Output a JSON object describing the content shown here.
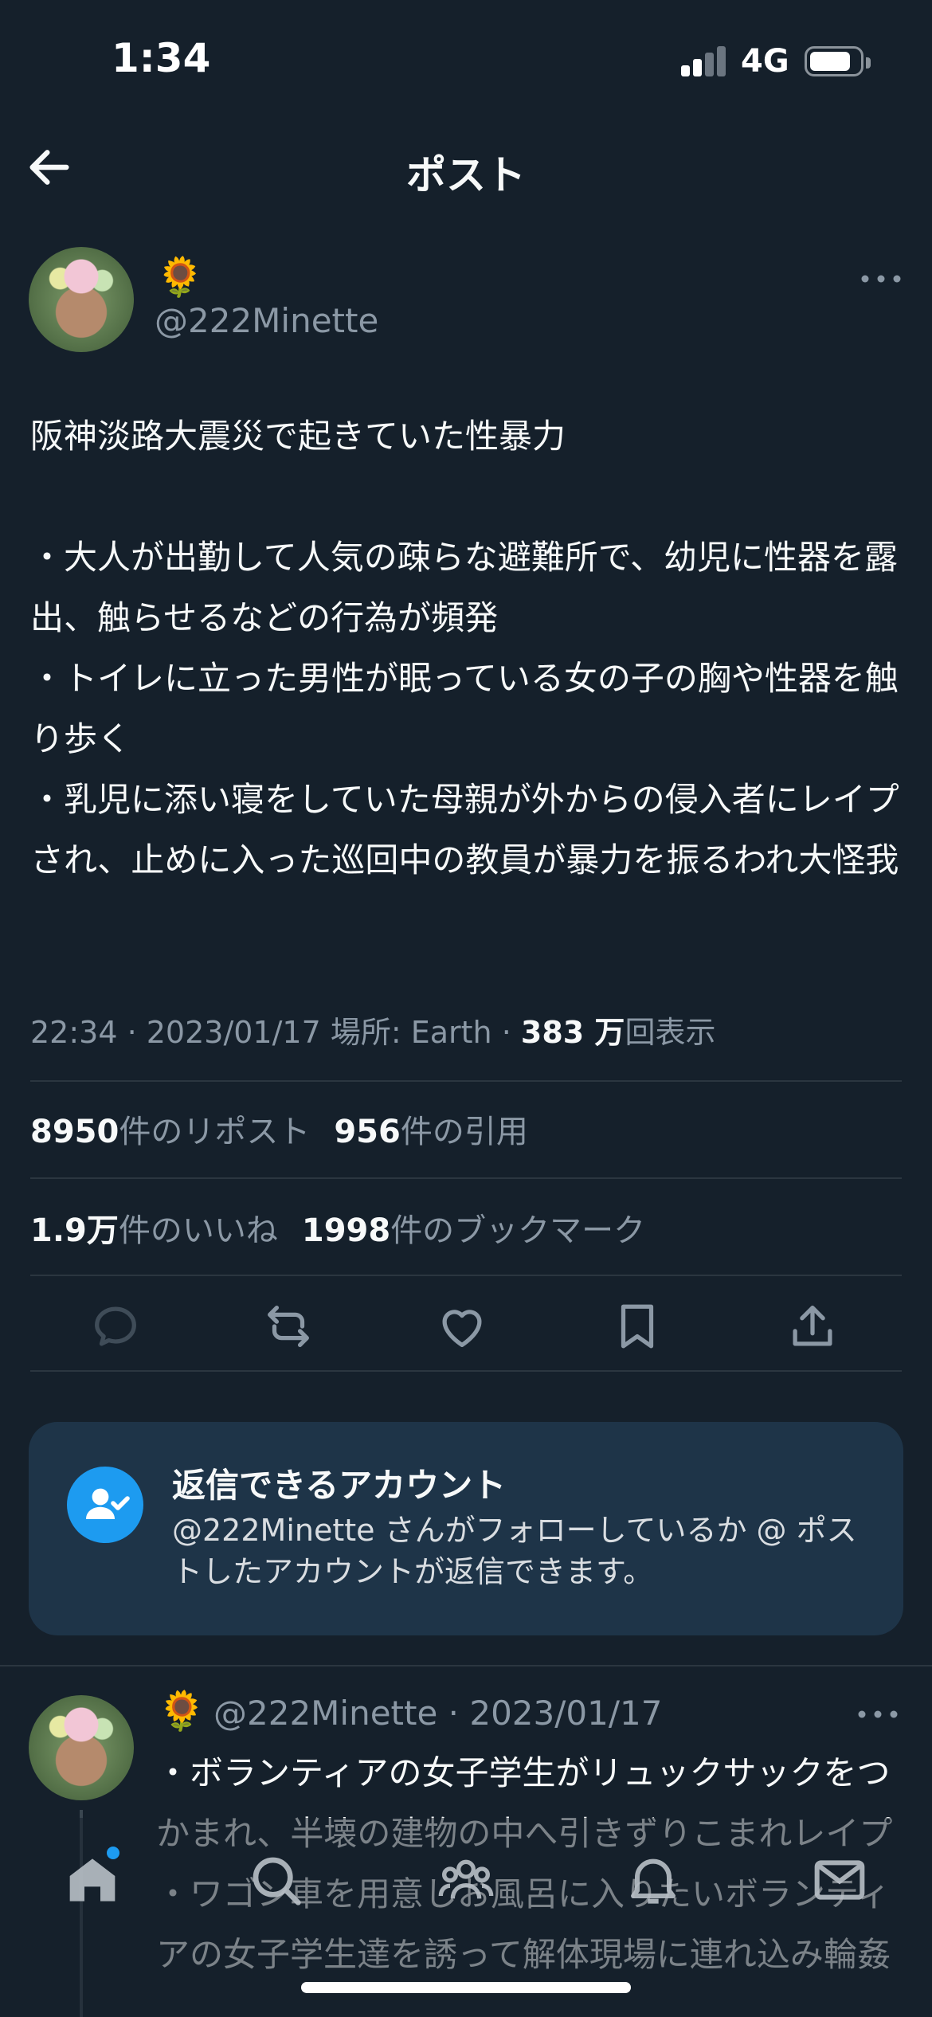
{
  "status_bar": {
    "time": "1:34",
    "network": "4G"
  },
  "nav": {
    "title": "ポスト"
  },
  "post": {
    "author_emoji": "🌻",
    "handle": "@222Minette",
    "body": "阪神淡路大震災で起きていた性暴力\n\n・大人が出勤して人気の疎らな避難所で、幼児に性器を露出、触らせるなどの行為が頻発\n・トイレに立った男性が眠っている女の子の胸や性器を触り歩く\n・乳児に添い寝をしていた母親が外からの侵入者にレイプされ、止めに入った巡回中の教員が暴力を振るわれ大怪我",
    "time": "22:34 · 2023/01/17 場所: Earth · ",
    "views_value": "383 万",
    "views_label": "回表示"
  },
  "stats": {
    "reposts_value": "8950",
    "reposts_label": "件のリポスト",
    "quotes_value": "956",
    "quotes_label": "件の引用",
    "likes_value": "1.9万",
    "likes_label": "件のいいね",
    "bookmarks_value": "1998",
    "bookmarks_label": "件のブックマーク"
  },
  "reply_settings": {
    "title": "返信できるアカウント",
    "description": "@222Minette さんがフォローしているか @ ポストしたアカウントが返信できます。"
  },
  "reply": {
    "author_emoji": "🌻",
    "handle_date": "@222Minette · 2023/01/17",
    "body": "・ボランティアの女子学生がリュックサックをつかまれ、半壊の建物の中へ引きずりこまれレイプ\n・ワゴン車を用意しお風呂に入りたいボランティアの女子学生達を誘って解体現場に連れ込み輪姦\n\n“こうした被害を警察や行政に申し入れても放置"
  },
  "colors": {
    "background": "#15202b",
    "accent": "#1d9bf0",
    "muted": "#8b98a5"
  }
}
